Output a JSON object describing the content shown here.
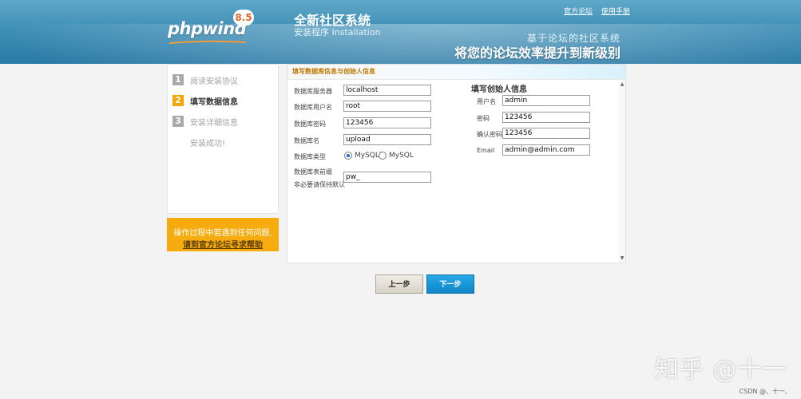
{
  "header": {
    "logo_text": "phpwind",
    "logo_version": "8.5",
    "product_title": "全新社区系统",
    "product_sub": "安装程序 Installation",
    "links": [
      "官方论坛",
      "使用手册"
    ],
    "slogan_small": "基于论坛的社区系统",
    "slogan_big": "将您的论坛效率提升到新级别"
  },
  "steps": [
    {
      "num": "1",
      "label": "阅读安装协议",
      "active": false
    },
    {
      "num": "2",
      "label": "填写数据信息",
      "active": true
    },
    {
      "num": "3",
      "label": "安装详细信息",
      "active": false
    },
    {
      "num": "",
      "label": "安装成功!",
      "active": false
    }
  ],
  "help": {
    "line1": "操作过程中若遇到任何问题,",
    "line2": "请到官方论坛寻求帮助"
  },
  "panel": {
    "heading": "填写数据库信息与创始人信息",
    "db": {
      "server_label": "数据库服务器",
      "server_value": "localhost",
      "user_label": "数据库用户名",
      "user_value": "root",
      "password_label": "数据库密码",
      "password_value": "123456",
      "name_label": "数据库名",
      "name_value": "upload",
      "type_label": "数据库类型",
      "type_options": [
        "MySQLi",
        "MySQL"
      ],
      "type_selected": "MySQLi",
      "prefix_label": "数据库表前缀",
      "prefix_note": "非必要请保持默认",
      "prefix_value": "pw_"
    },
    "admin": {
      "section_title": "填写创始人信息",
      "username_label": "用户名",
      "username_value": "admin",
      "password_label": "密码",
      "password_value": "123456",
      "confirm_label": "确认密码",
      "confirm_value": "123456",
      "email_label": "Email",
      "email_value": "admin@admin.com"
    }
  },
  "buttons": {
    "prev": "上一步",
    "next": "下一步"
  },
  "watermark": "知乎 @十一",
  "csdn": "CSDN @、十一、"
}
